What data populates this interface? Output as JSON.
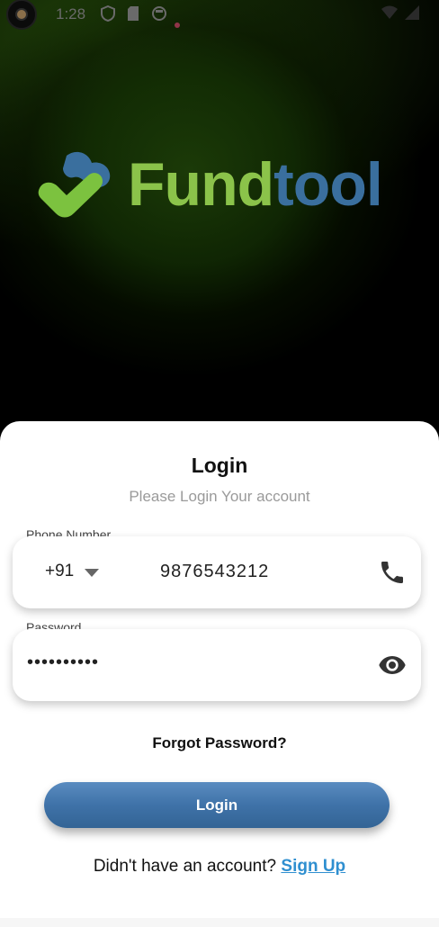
{
  "status_bar": {
    "time": "1:28",
    "icons": [
      "camera-icon",
      "shield-icon",
      "sim-card-icon",
      "circle-app-icon",
      "wifi-icon",
      "signal-icon"
    ]
  },
  "brand": {
    "part1": "Fund",
    "part2": "tool",
    "colors": {
      "green": "#8bc34a",
      "blue": "#3a6f9e"
    }
  },
  "login": {
    "title": "Login",
    "subtitle": "Please Login Your account",
    "phone_label": "Phone Number",
    "country_code": "+91",
    "phone_value": "9876543212",
    "password_label": "Password",
    "password_value": "••••••••••",
    "forgot": "Forgot Password?",
    "button": "Login",
    "signup_prompt": "Didn't have an account?",
    "signup_link": "Sign Up"
  },
  "colors": {
    "accent": "#3f72a8",
    "link": "#2f8fd0"
  }
}
